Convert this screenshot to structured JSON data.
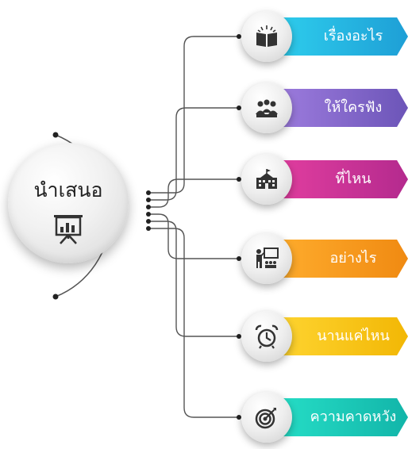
{
  "hub": {
    "title": "นำเสนอ",
    "icon": "presentation-board-icon"
  },
  "items": [
    {
      "label": "เรื่องอะไร",
      "icon": "open-book-icon",
      "color_start": "#2fd0ee",
      "color_end": "#1e9fd6"
    },
    {
      "label": "ให้ใครฟัง",
      "icon": "audience-group-icon",
      "color_start": "#a07ee0",
      "color_end": "#6c55b8"
    },
    {
      "label": "ที่ไหน",
      "icon": "school-building-icon",
      "color_start": "#e43fa0",
      "color_end": "#b42a8e"
    },
    {
      "label": "อย่างไร",
      "icon": "teacher-board-icon",
      "color_start": "#ffae2e",
      "color_end": "#f08a12"
    },
    {
      "label": "นานแค่ไหน",
      "icon": "alarm-clock-icon",
      "color_start": "#ffd633",
      "color_end": "#f2b705"
    },
    {
      "label": "ความคาดหวัง",
      "icon": "target-icon",
      "color_start": "#27e0c8",
      "color_end": "#12b5a9"
    }
  ],
  "colors": {
    "wire": "#555555",
    "dot": "#222222",
    "icon": "#333333"
  }
}
